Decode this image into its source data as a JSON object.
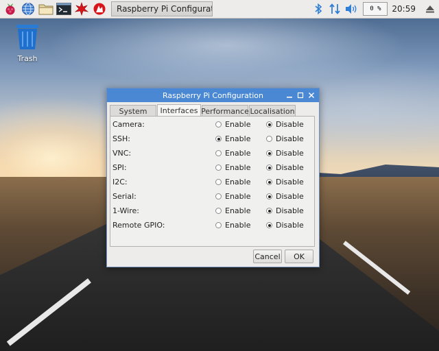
{
  "taskbar": {
    "launchers": [
      "raspberry-menu-icon",
      "web-browser-icon",
      "file-manager-icon",
      "terminal-icon",
      "wolfram-icon",
      "mathematica-icon"
    ],
    "task_label": "Raspberry Pi Configurati...",
    "cpu": "0 %",
    "clock": "20:59",
    "tray": [
      "bluetooth-icon",
      "network-icon",
      "volume-icon"
    ]
  },
  "desktop": {
    "trash_label": "Trash"
  },
  "dialog": {
    "title": "Raspberry Pi Configuration",
    "tabs": [
      {
        "label": "System",
        "active": false
      },
      {
        "label": "Interfaces",
        "active": true
      },
      {
        "label": "Performance",
        "active": false
      },
      {
        "label": "Localisation",
        "active": false
      }
    ],
    "option_labels": {
      "enable": "Enable",
      "disable": "Disable"
    },
    "interfaces": [
      {
        "label": "Camera:",
        "selected": "disable"
      },
      {
        "label": "SSH:",
        "selected": "enable"
      },
      {
        "label": "VNC:",
        "selected": "disable"
      },
      {
        "label": "SPI:",
        "selected": "disable"
      },
      {
        "label": "I2C:",
        "selected": "disable"
      },
      {
        "label": "Serial:",
        "selected": "disable"
      },
      {
        "label": "1-Wire:",
        "selected": "disable"
      },
      {
        "label": "Remote GPIO:",
        "selected": "disable"
      }
    ],
    "buttons": {
      "cancel": "Cancel",
      "ok": "OK"
    }
  },
  "colors": {
    "titlebar": "#4a88d4",
    "accent_blue": "#2f7fd6"
  }
}
